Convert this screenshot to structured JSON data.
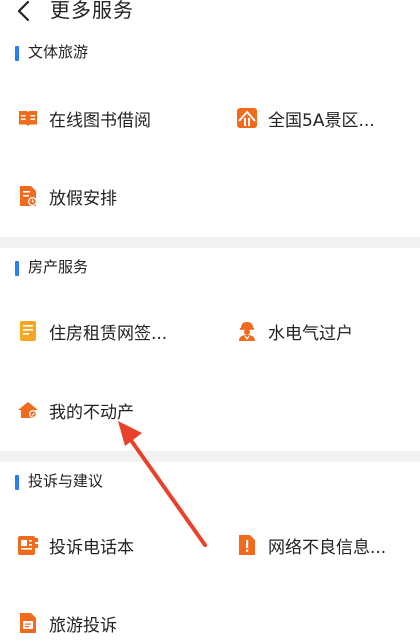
{
  "header": {
    "title": "更多服务"
  },
  "sections": [
    {
      "title": "文体旅游",
      "items": [
        "在线图书借阅",
        "全国5A景区...",
        "放假安排"
      ]
    },
    {
      "title": "房产服务",
      "items": [
        "住房租赁网签...",
        "水电气过户",
        "我的不动产"
      ]
    },
    {
      "title": "投诉与建议",
      "items": [
        "投诉电话本",
        "网络不良信息...",
        "旅游投诉"
      ]
    }
  ],
  "icons": {
    "book": "book-icon",
    "mountain": "mountain-icon",
    "calendar": "calendar-icon",
    "doc": "document-icon",
    "worker": "worker-icon",
    "house": "house-icon",
    "phonebook": "phonebook-icon",
    "alert": "alert-icon",
    "complaint": "complaint-icon"
  },
  "colors": {
    "accent": "#2b7cf6",
    "icon": "#f26b1d",
    "icon_yellow": "#f5a623",
    "divider": "#f2f2f2",
    "annotation": "#e8412c"
  }
}
